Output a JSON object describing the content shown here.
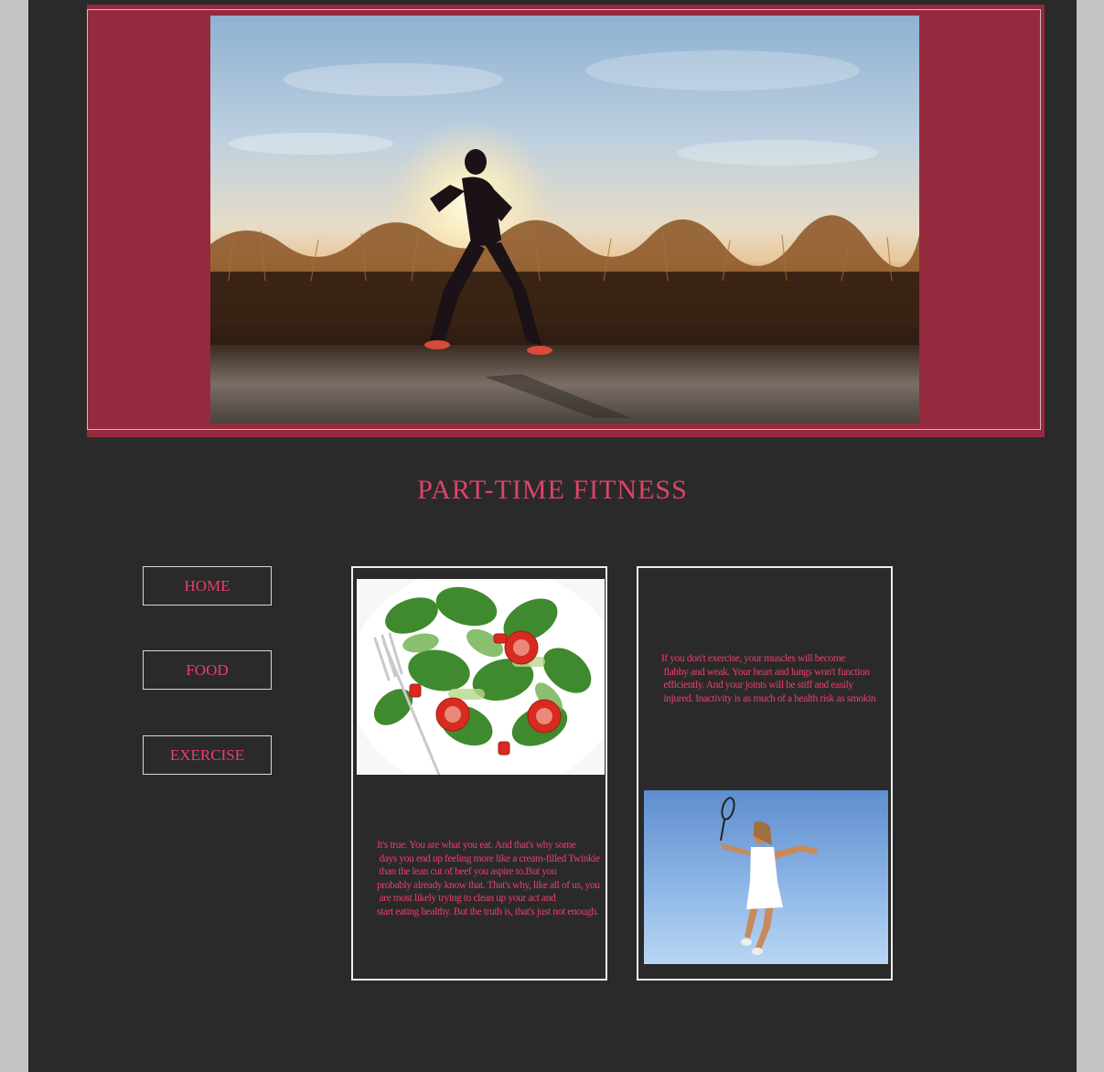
{
  "header": {
    "hero_alt": "Runner silhouetted at sunrise"
  },
  "site_title": "PART-TIME FITNESS",
  "nav": {
    "home": "HOME",
    "food": "FOOD",
    "exercise": "EXERCISE"
  },
  "food_card": {
    "image_alt": "Spinach and tomato salad with fork",
    "text": "It's true. You are what you eat. And that's why some\n days you end up feeling more like a cream-filled Twinkie\n than the lean cut of beef you aspire to.But you\nprobably already know that. That's why, like all of us, you\n are most likely trying to clean up your act and\nstart eating healthy. But the truth is, that's just not enough."
  },
  "exercise_card": {
    "text": "If you don't exercise, your muscles will become\n flabby and weak. Your heart and lungs won't function\n efficiently. And your joints will be stiff and easily\n injured. Inactivity is as much of a health risk as smokin",
    "image_alt": "Tennis player leaping against blue sky"
  },
  "colors": {
    "accent": "#ea3f6a",
    "banner": "#952a3e",
    "page_bg": "#2a2a2a",
    "outer_bg": "#c4c4c4"
  }
}
